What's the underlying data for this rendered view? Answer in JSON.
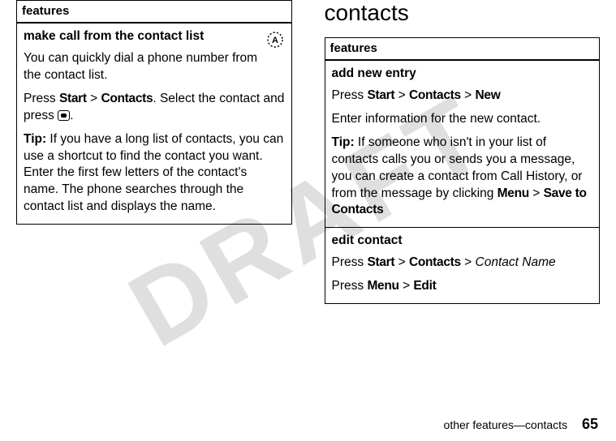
{
  "watermark": "DRAFT",
  "left": {
    "header": "features",
    "cell": {
      "title": "make call from the contact list",
      "p1": "You can quickly dial a phone number from the contact list.",
      "p2_pre": "Press ",
      "p2_start": "Start",
      "p2_gt1": " > ",
      "p2_contacts": "Contacts",
      "p2_post": ". Select the contact and press ",
      "p2_end": ".",
      "tip_label": "Tip:",
      "tip_body": " If you have a long list of contacts, you can use a shortcut to find the contact you want. Enter the first few letters of the contact's name. The phone searches through the contact list and displays the name."
    }
  },
  "right": {
    "section": "contacts",
    "header": "features",
    "add": {
      "title": "add new entry",
      "p1_press": "Press ",
      "p1_start": "Start",
      "p1_gt1": " > ",
      "p1_contacts": "Contacts",
      "p1_gt2": " > ",
      "p1_new": "New",
      "p2": "Enter information for the new contact.",
      "tip_label": "Tip:",
      "tip_body": " If someone who isn't in your list of contacts calls you or sends you a message, you can create a contact from Call History, or from the message by clicking ",
      "tip_menu": "Menu",
      "tip_gt": " > ",
      "tip_save": "Save to Contacts"
    },
    "edit": {
      "title": "edit contact",
      "p1_press": "Press ",
      "p1_start": "Start",
      "p1_gt1": " > ",
      "p1_contacts": "Contacts",
      "p1_gt2": " > ",
      "p1_name": "Contact Name",
      "p2_press": "Press ",
      "p2_menu": "Menu",
      "p2_gt": " > ",
      "p2_edit": "Edit"
    }
  },
  "footer": {
    "text": "other features—contacts",
    "page": "65"
  }
}
